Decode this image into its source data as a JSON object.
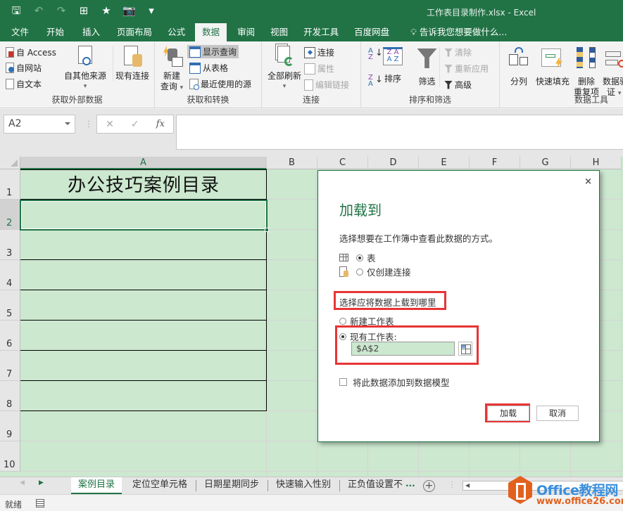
{
  "window": {
    "title": "工作表目录制作.xlsx - Excel"
  },
  "quick_access": [
    {
      "icon": "save-icon",
      "glyph": "🖫"
    },
    {
      "icon": "undo-icon",
      "glyph": "↶"
    },
    {
      "icon": "redo-icon",
      "glyph": "↷"
    },
    {
      "icon": "form-icon",
      "glyph": "⊞"
    },
    {
      "icon": "favorites-icon",
      "glyph": "★"
    },
    {
      "icon": "camera-icon",
      "glyph": "📷"
    },
    {
      "icon": "customize-qat-icon",
      "glyph": "▾"
    }
  ],
  "ribbon_tabs": [
    "文件",
    "开始",
    "插入",
    "页面布局",
    "公式",
    "数据",
    "审阅",
    "视图",
    "开发工具",
    "百度网盘"
  ],
  "active_tab": "数据",
  "tell_me": "告诉我您想要做什么...",
  "ribbon": {
    "get_external": {
      "label": "获取外部数据",
      "from_access": "自 Access",
      "from_web": "自网站",
      "from_text": "自文本",
      "from_other": "自其他来源",
      "existing": "现有连接"
    },
    "get_transform": {
      "label": "获取和转换",
      "new_query_1": "新建",
      "new_query_2": "查询",
      "show_queries": "显示查询",
      "from_table": "从表格",
      "recent_sources": "最近使用的源"
    },
    "connections": {
      "label": "连接",
      "refresh_all": "全部刷新",
      "connections": "连接",
      "properties": "属性",
      "edit_links": "编辑链接"
    },
    "sort_filter": {
      "label": "排序和筛选",
      "sort": "排序",
      "filter": "筛选",
      "clear": "清除",
      "reapply": "重新应用",
      "advanced": "高级"
    },
    "data_tools": {
      "label": "数据工具",
      "text_to_columns": "分列",
      "flash_fill": "快速填充",
      "remove_dup_1": "删除",
      "remove_dup_2": "重复项",
      "validation_1": "数据验",
      "validation_2": "证"
    }
  },
  "formula_bar": {
    "name_box": "A2",
    "cancel": "✕",
    "enter": "✓",
    "fx": "fx",
    "value": ""
  },
  "grid": {
    "columns": [
      "A",
      "B",
      "C",
      "D",
      "E",
      "F",
      "G",
      "H"
    ],
    "rows": [
      "1",
      "2",
      "3",
      "4",
      "5",
      "6",
      "7",
      "8",
      "9",
      "10"
    ],
    "selected_cell": "A2",
    "A1": "办公技巧案例目录"
  },
  "dialog": {
    "close": "×",
    "title": "加载到",
    "instruction": "选择想要在工作簿中查看此数据的方式。",
    "view_options": [
      {
        "label": "表",
        "selected": true
      },
      {
        "label": "仅创建连接",
        "selected": false
      }
    ],
    "location_heading": "选择应将数据上载到哪里",
    "location_options": [
      {
        "label": "新建工作表",
        "selected": false
      },
      {
        "label": "现有工作表:",
        "selected": true
      }
    ],
    "range_value": "$A$2",
    "add_to_model": "将此数据添加到数据模型",
    "add_to_model_checked": false,
    "load_button": "加载",
    "cancel_button": "取消"
  },
  "sheet_tabs": [
    "案例目录",
    "定位空单元格",
    "日期星期同步",
    "快速输入性别",
    "正负值设置不"
  ],
  "active_sheet": "案例目录",
  "more_tabs": "...",
  "status": "就绪",
  "watermark": {
    "name": "Office教程网",
    "url": "www.office26.com"
  }
}
